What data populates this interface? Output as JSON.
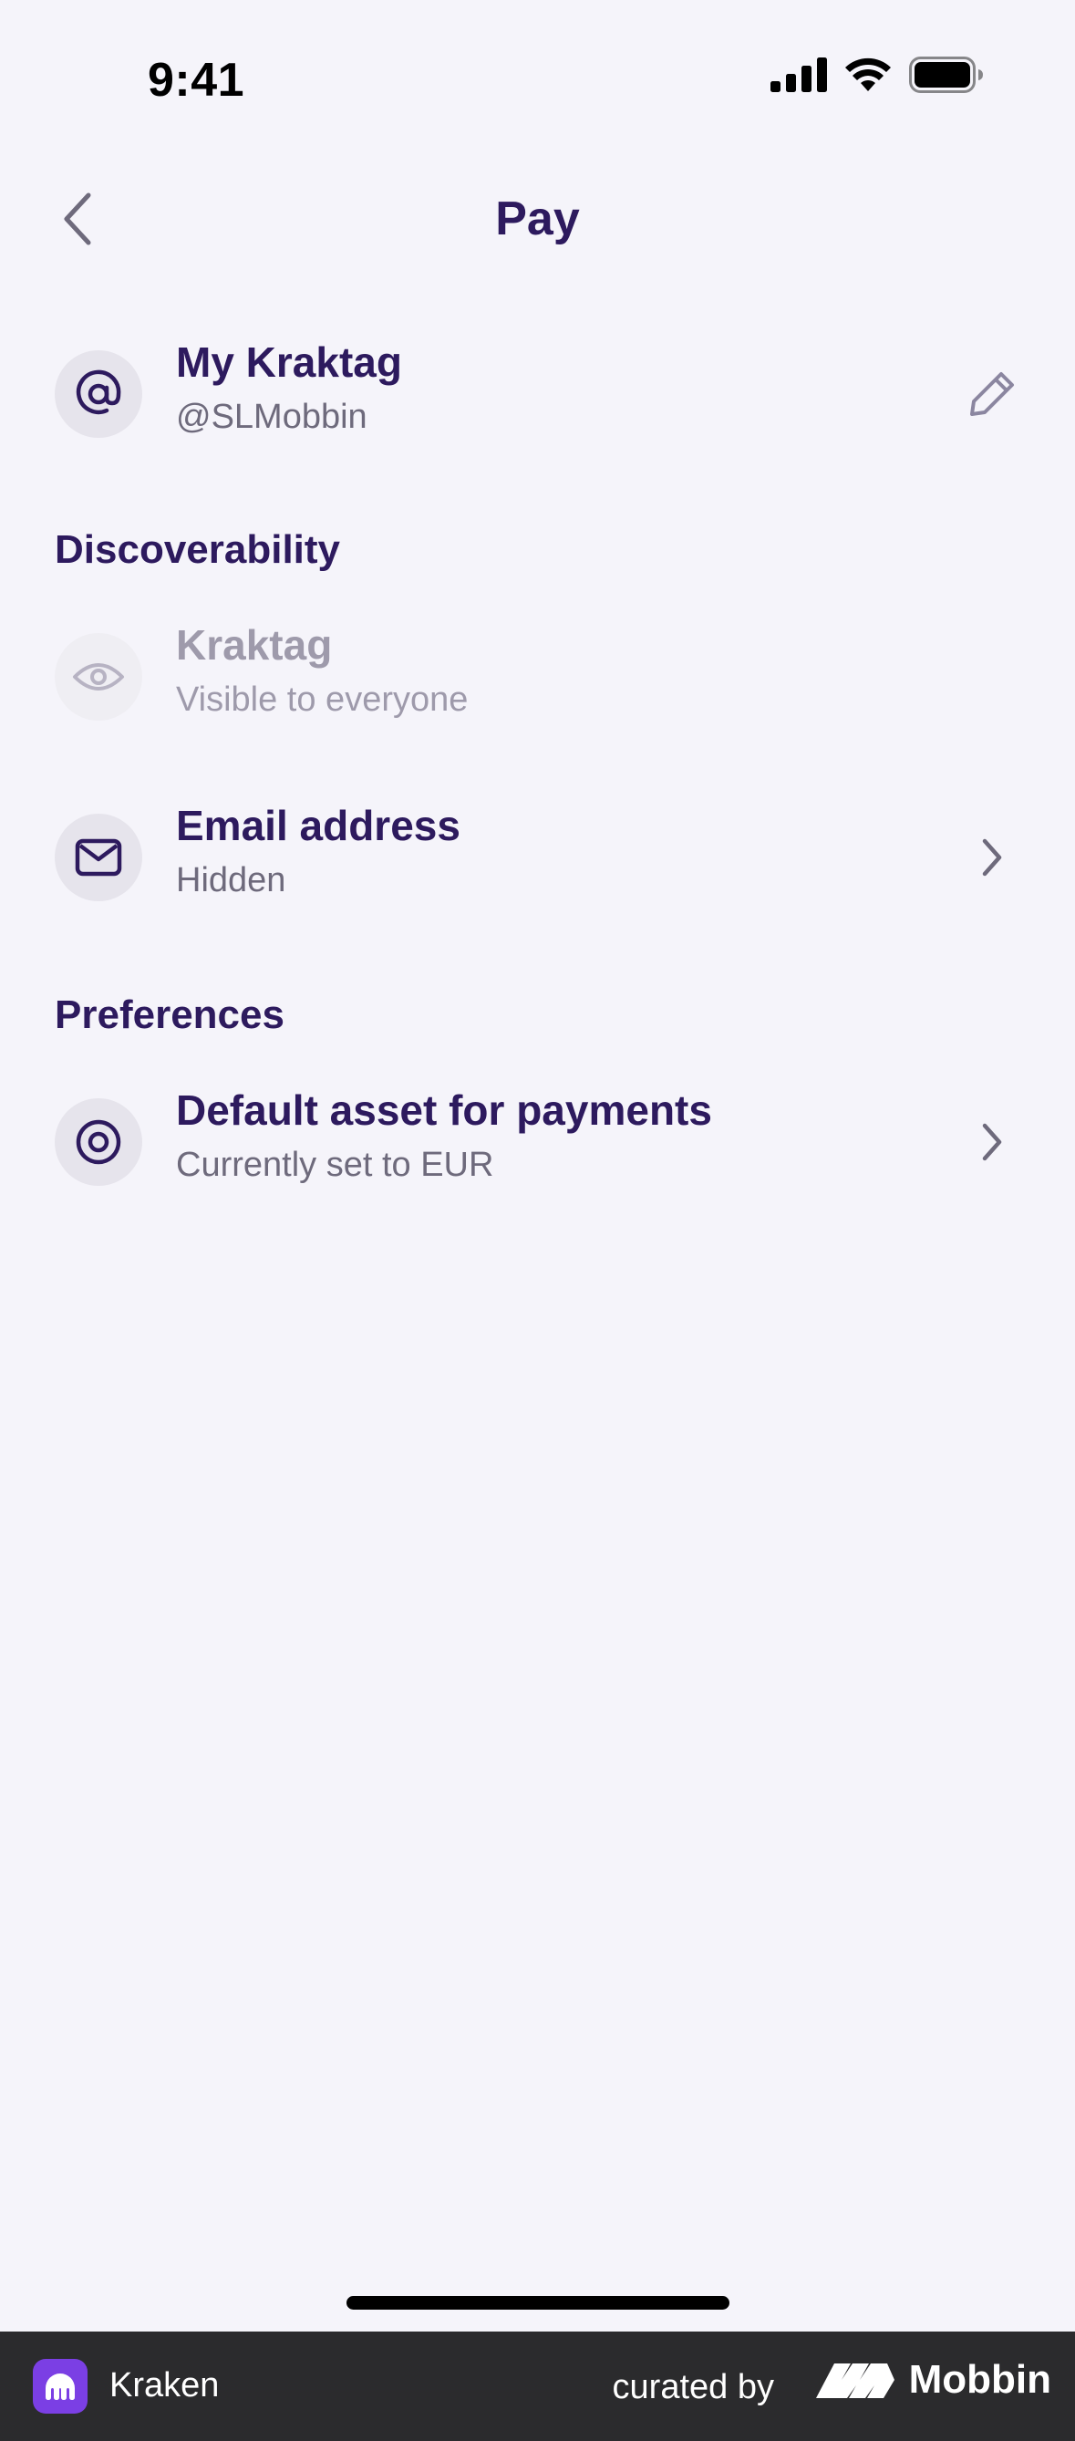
{
  "status_bar": {
    "time": "9:41",
    "icons": [
      "cellular-signal-icon",
      "wifi-icon",
      "battery-icon"
    ]
  },
  "nav": {
    "title": "Pay",
    "back_icon": "chevron-left-icon"
  },
  "kraktag": {
    "icon": "at-sign-icon",
    "title": "My Kraktag",
    "handle": "@SLMobbin",
    "edit_icon": "pencil-icon"
  },
  "discoverability": {
    "heading": "Discoverability",
    "items": [
      {
        "icon": "eye-icon",
        "title": "Kraktag",
        "subtitle": "Visible to everyone",
        "enabled": false
      },
      {
        "icon": "envelope-icon",
        "title": "Email address",
        "subtitle": "Hidden",
        "enabled": true,
        "trailing_icon": "chevron-right-icon"
      }
    ]
  },
  "preferences": {
    "heading": "Preferences",
    "items": [
      {
        "icon": "target-icon",
        "title": "Default asset for payments",
        "subtitle": "Currently set to EUR",
        "trailing_icon": "chevron-right-icon"
      }
    ]
  },
  "footer": {
    "app_name": "Kraken",
    "curated_by": "curated by",
    "brand": "Mobbin"
  },
  "colors": {
    "background": "#f5f4fa",
    "primary_text": "#2d1a5e",
    "secondary_text": "#6e6a7c",
    "disabled_text": "#9e9aab",
    "icon_circle": "#e6e4ec",
    "kraken_purple": "#7b3fe4",
    "footer_bg": "#2b2b2d"
  }
}
